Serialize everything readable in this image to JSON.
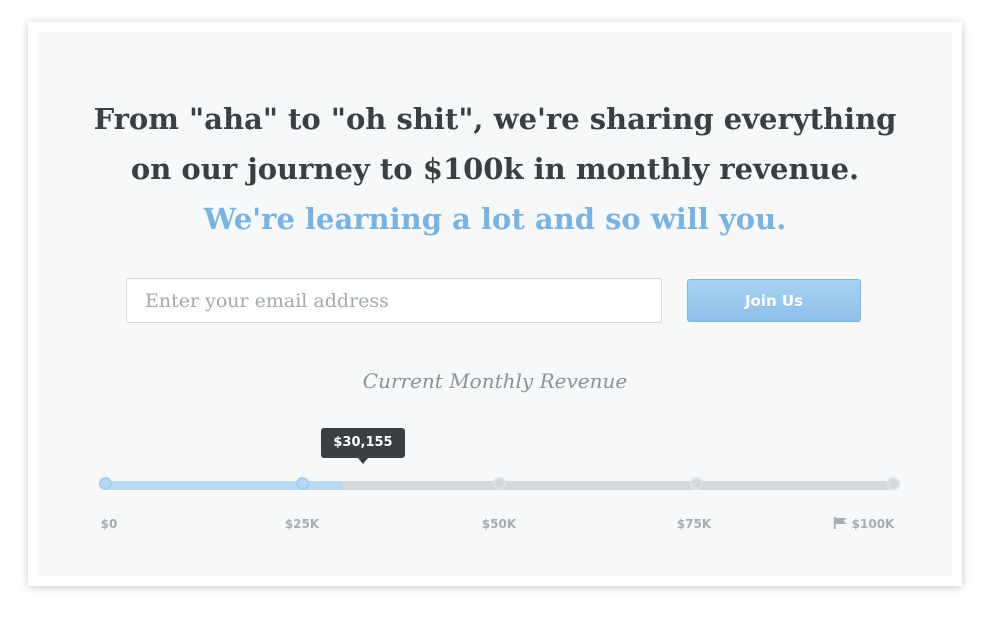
{
  "headline": {
    "line1": "From \"aha\" to \"oh shit\", we're sharing everything",
    "line2": "on our journey to $100k in monthly revenue.",
    "line3": "We're learning a lot and so will you."
  },
  "signup": {
    "email_placeholder": "Enter your email address",
    "email_value": "",
    "button_label": "Join Us"
  },
  "revenue": {
    "label": "Current Monthly Revenue",
    "current_value_text": "$30,155",
    "current_value": 30155,
    "goal": 100000,
    "ticks": [
      "$0",
      "$25K",
      "$50K",
      "$75K",
      "$100K"
    ],
    "goal_icon": "flag-icon"
  },
  "colors": {
    "accent": "#7ab3df",
    "button": "#8dc1e8",
    "track": "#d5d8db",
    "fill": "#b7d9f3"
  }
}
